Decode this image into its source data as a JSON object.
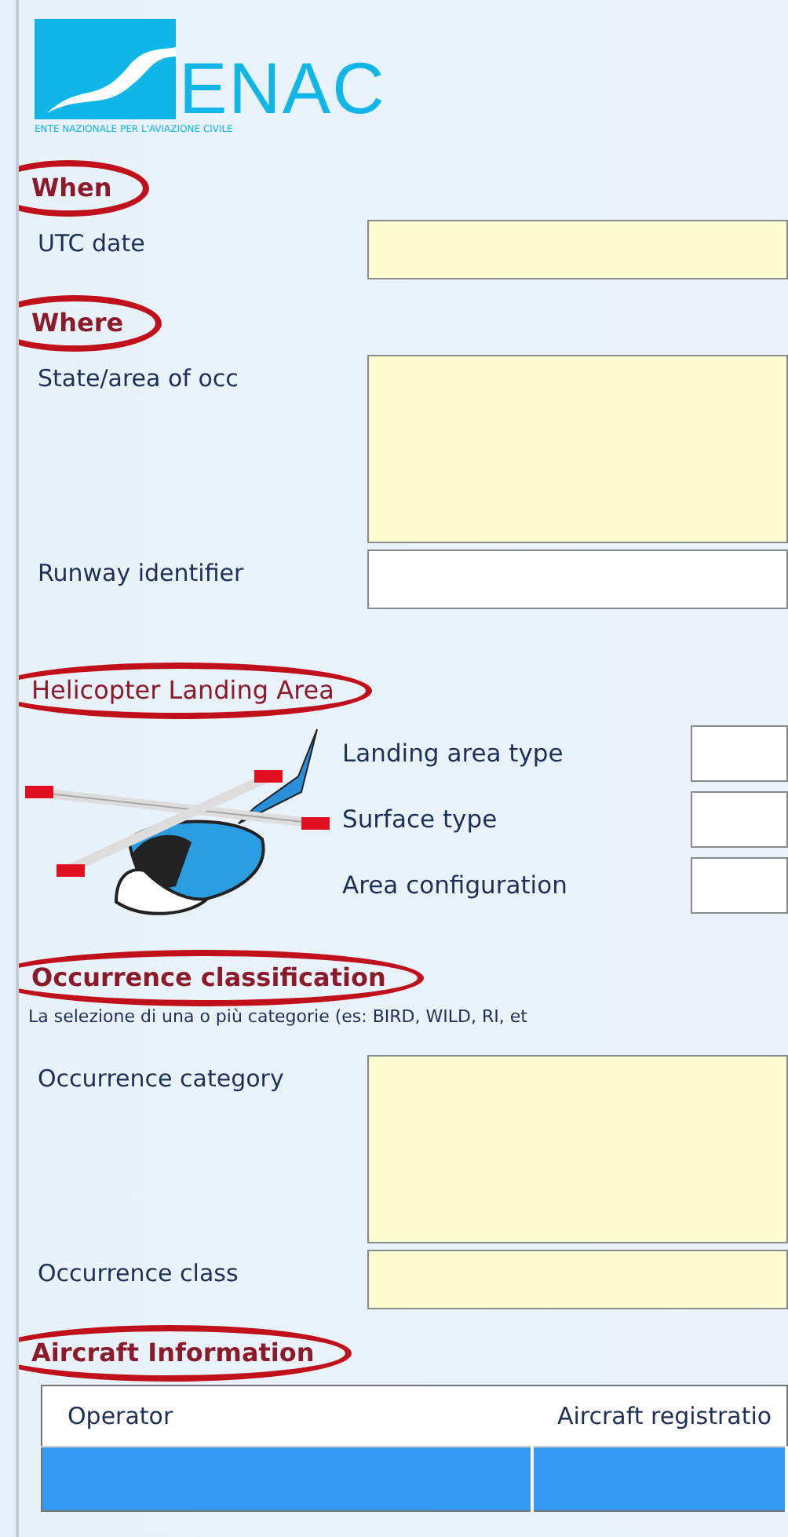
{
  "logo": {
    "name": "ENAC",
    "tagline": "ENTE NAZIONALE PER L'AVIAZIONE CIVILE"
  },
  "sections": [
    {
      "kind": "form",
      "heading": "When",
      "bold": true,
      "circled": true,
      "fields": [
        {
          "label": "UTC date",
          "kind": "line",
          "required": true
        }
      ]
    },
    {
      "kind": "form",
      "heading": "Where",
      "bold": true,
      "circled": true,
      "fields": [
        {
          "label": "State/area of occ",
          "kind": "area",
          "required": true
        },
        {
          "label": "Runway identifier",
          "kind": "line",
          "required": false
        }
      ]
    },
    {
      "kind": "helicopter",
      "heading": "Helicopter Landing Area",
      "bold": false,
      "circled": true,
      "fields": [
        {
          "label": "Landing area type",
          "kind": "line",
          "required": false
        },
        {
          "label": "Surface type",
          "kind": "line",
          "required": false
        },
        {
          "label": "Area configuration",
          "kind": "line",
          "required": false
        }
      ]
    },
    {
      "kind": "form",
      "heading": "Occurrence classification",
      "bold": true,
      "circled": true,
      "note": "La selezione di una o più categorie (es: BIRD, WILD, RI, et",
      "fields": [
        {
          "label": "Occurrence category",
          "kind": "area",
          "required": true
        },
        {
          "label": "Occurrence class",
          "kind": "line",
          "required": true
        }
      ]
    },
    {
      "kind": "table",
      "heading": "Aircraft Information",
      "bold": true,
      "circled": true,
      "columns": [
        "Operator",
        "Aircraft registratio"
      ],
      "rows": [
        {
          "selected": true
        }
      ]
    }
  ]
}
